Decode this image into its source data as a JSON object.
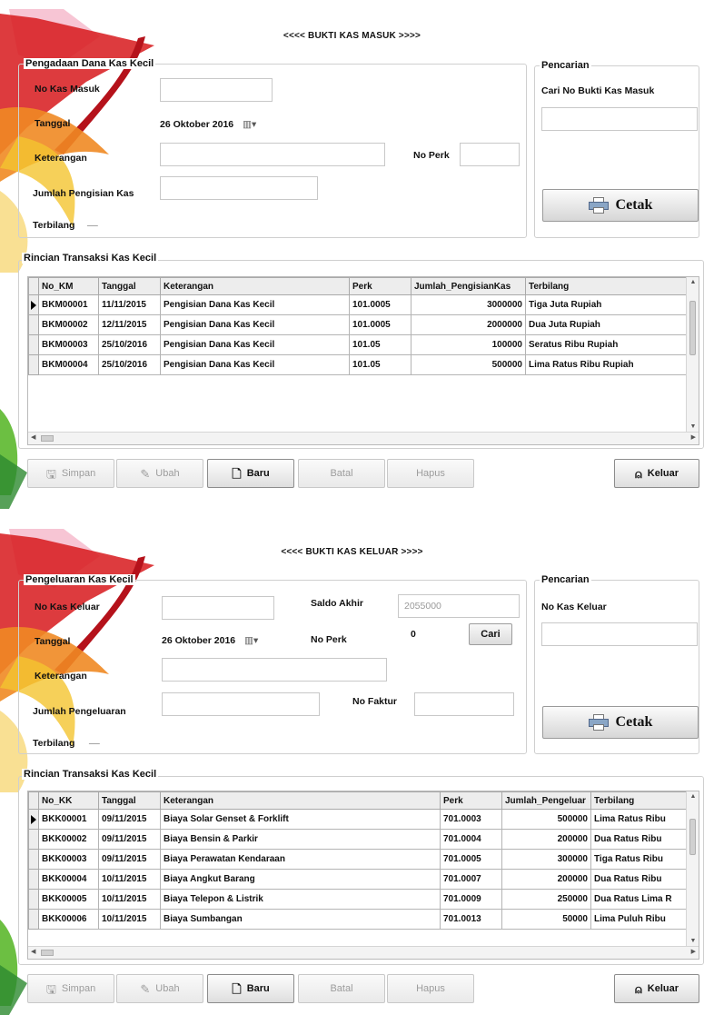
{
  "masuk": {
    "title": "<<<< BUKTI KAS MASUK >>>>",
    "form": {
      "legend": "Pengadaan Dana Kas Kecil",
      "no_label": "No Kas Masuk",
      "no_value": "",
      "tanggal_label": "Tanggal",
      "tanggal_value": "26  Oktober  2016",
      "keterangan_label": "Keterangan",
      "keterangan_value": "",
      "noperk_label": "No Perk",
      "noperk_value": "",
      "jumlah_label": "Jumlah Pengisian Kas",
      "jumlah_value": "",
      "terbilang_label": "Terbilang",
      "terbilang_value": "__"
    },
    "search": {
      "legend": "Pencarian",
      "label": "Cari No Bukti Kas Masuk",
      "value": "",
      "cetak_label": "Cetak"
    },
    "grid": {
      "legend": "Rincian Transaksi Kas Kecil",
      "columns": [
        "No_KM",
        "Tanggal",
        "Keterangan",
        "Perk",
        "Jumlah_PengisianKas",
        "Terbilang"
      ],
      "rows": [
        [
          "BKM00001",
          "11/11/2015",
          "Pengisian Dana Kas Kecil",
          "101.0005",
          "3000000",
          "Tiga Juta  Rupiah"
        ],
        [
          "BKM00002",
          "12/11/2015",
          "Pengisian Dana Kas Kecil",
          "101.0005",
          "2000000",
          "Dua Juta  Rupiah"
        ],
        [
          "BKM00003",
          "25/10/2016",
          "Pengisian Dana Kas Kecil",
          "101.05",
          "100000",
          "Seratus Ribu  Rupiah"
        ],
        [
          "BKM00004",
          "25/10/2016",
          "Pengisian Dana Kas Kecil",
          "101.05",
          "500000",
          "Lima Ratus Ribu  Rupiah"
        ]
      ]
    },
    "toolbar": {
      "simpan": "Simpan",
      "ubah": "Ubah",
      "baru": "Baru",
      "batal": "Batal",
      "hapus": "Hapus",
      "keluar": "Keluar"
    }
  },
  "keluar": {
    "title": "<<<< BUKTI KAS KELUAR >>>>",
    "form": {
      "legend": "Pengeluaran Kas Kecil",
      "no_label": "No Kas Keluar",
      "no_value": "",
      "saldo_label": "Saldo Akhir",
      "saldo_value": "2055000",
      "tanggal_label": "Tanggal",
      "tanggal_value": "26  Oktober  2016",
      "noperk_label": "No Perk",
      "noperk_value": "0",
      "cari_label": "Cari",
      "keterangan_label": "Keterangan",
      "keterangan_value": "",
      "jumlah_label": "Jumlah Pengeluaran",
      "jumlah_value": "",
      "faktur_label": "No Faktur",
      "faktur_value": "",
      "terbilang_label": "Terbilang",
      "terbilang_value": "__"
    },
    "search": {
      "legend": "Pencarian",
      "label": "No Kas Keluar",
      "value": "",
      "cetak_label": "Cetak"
    },
    "grid": {
      "legend": "Rincian Transaksi Kas Kecil",
      "columns": [
        "No_KK",
        "Tanggal",
        "Keterangan",
        "Perk",
        "Jumlah_Pengeluar",
        "Terbilang"
      ],
      "rows": [
        [
          "BKK00001",
          "09/11/2015",
          "Biaya Solar Genset & Forklift",
          "701.0003",
          "500000",
          "Lima Ratus Ribu"
        ],
        [
          "BKK00002",
          "09/11/2015",
          "Biaya Bensin & Parkir",
          "701.0004",
          "200000",
          "Dua Ratus Ribu"
        ],
        [
          "BKK00003",
          "09/11/2015",
          "Biaya Perawatan Kendaraan",
          "701.0005",
          "300000",
          "Tiga Ratus Ribu"
        ],
        [
          "BKK00004",
          "10/11/2015",
          "Biaya Angkut Barang",
          "701.0007",
          "200000",
          "Dua Ratus Ribu"
        ],
        [
          "BKK00005",
          "10/11/2015",
          "Biaya Telepon & Listrik",
          "701.0009",
          "250000",
          "Dua Ratus Lima R"
        ],
        [
          "BKK00006",
          "10/11/2015",
          "Biaya Sumbangan",
          "701.0013",
          "50000",
          "Lima Puluh Ribu"
        ]
      ]
    },
    "toolbar": {
      "simpan": "Simpan",
      "ubah": "Ubah",
      "baru": "Baru",
      "batal": "Batal",
      "hapus": "Hapus",
      "keluar": "Keluar"
    }
  },
  "colors": {
    "decor_red": "#d7191c",
    "decor_orange": "#f08a24",
    "decor_green": "#5cb82e"
  },
  "icons": [
    "decorative-splash-art",
    "calendar-dropdown-icon",
    "printer-icon",
    "save-icon",
    "edit-icon",
    "new-document-icon",
    "exit-icon",
    "row-pointer-icon"
  ]
}
